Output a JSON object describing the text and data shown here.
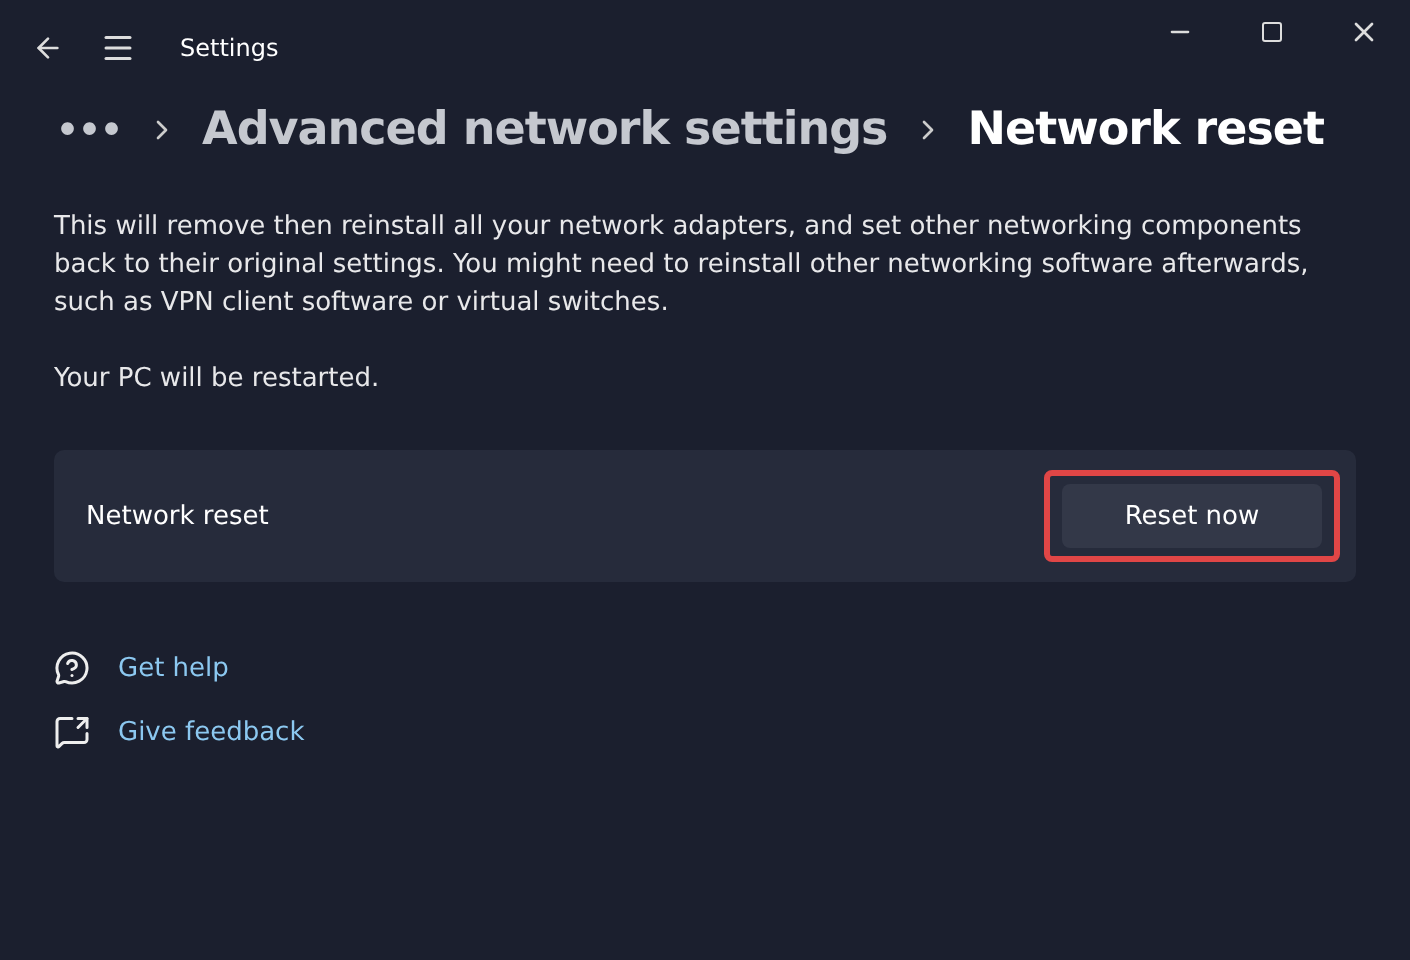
{
  "window": {
    "title": "Settings"
  },
  "breadcrumb": [
    {
      "label": "•••",
      "kind": "more"
    },
    {
      "label": "Advanced network settings",
      "kind": "parent"
    },
    {
      "label": "Network reset",
      "kind": "current"
    }
  ],
  "description": "This will remove then reinstall all your network adapters, and set other networking components back to their original settings. You might need to reinstall other networking software afterwards, such as VPN client software or virtual switches.",
  "note": "Your PC will be restarted.",
  "card": {
    "label": "Network reset",
    "button": {
      "label": "Reset now",
      "highlighted": true
    }
  },
  "links": [
    {
      "label": "Get help",
      "kind": "help"
    },
    {
      "label": "Give feedback",
      "kind": "feedback"
    }
  ]
}
